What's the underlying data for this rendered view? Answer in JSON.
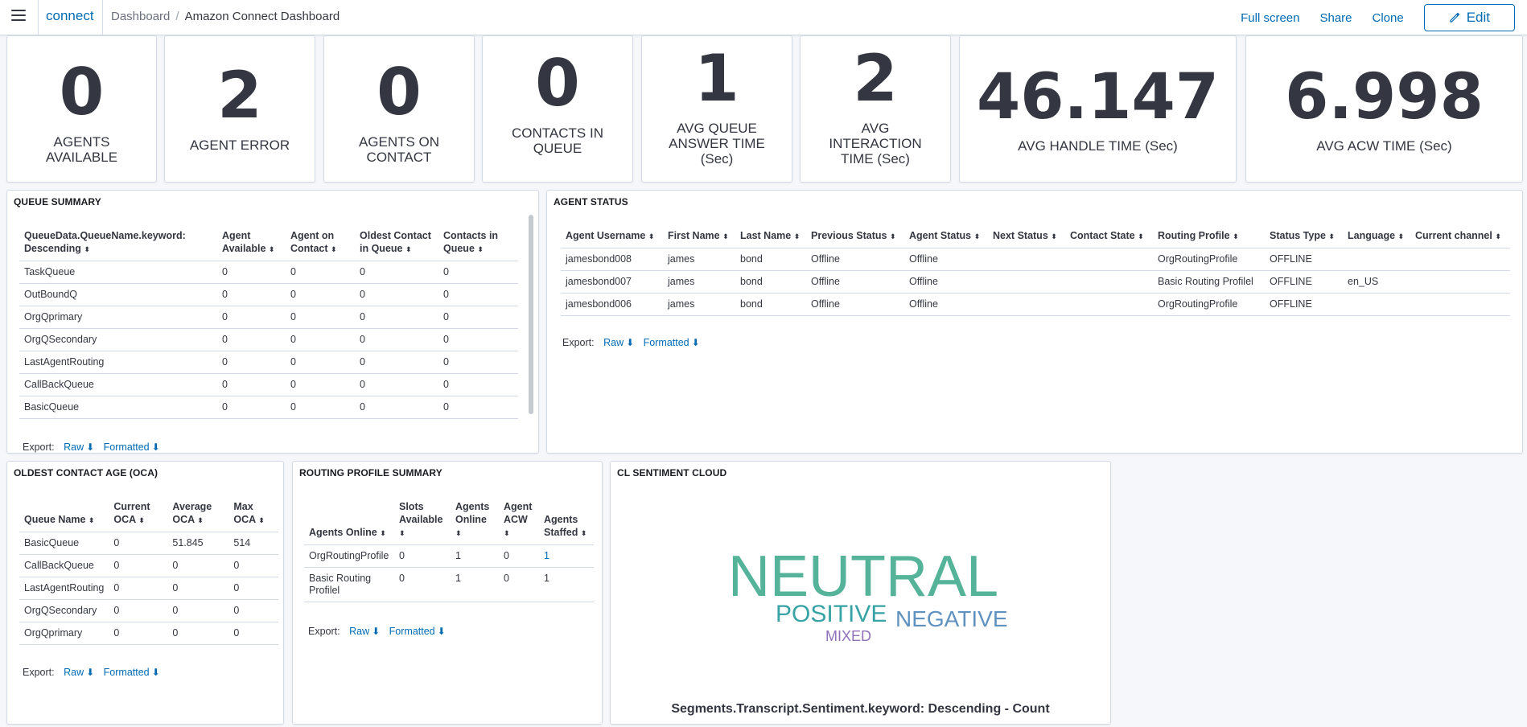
{
  "header": {
    "brand": "connect",
    "breadcrumb": [
      "Dashboard",
      "Amazon Connect Dashboard"
    ],
    "actions": [
      "Full screen",
      "Share",
      "Clone"
    ],
    "edit_label": "Edit"
  },
  "metrics": [
    {
      "value": "0",
      "label": "AGENTS AVAILABLE"
    },
    {
      "value": "2",
      "label": "AGENT ERROR"
    },
    {
      "value": "0",
      "label": "AGENTS ON CONTACT"
    },
    {
      "value": "0",
      "label": "CONTACTS IN QUEUE"
    },
    {
      "value": "1",
      "label": "AVG QUEUE ANSWER TIME (Sec)"
    },
    {
      "value": "2",
      "label": "AVG INTERACTION TIME (Sec)"
    },
    {
      "value": "46.147",
      "label": "AVG HANDLE TIME (Sec)"
    },
    {
      "value": "6.998",
      "label": "AVG ACW TIME (Sec)"
    }
  ],
  "queue_summary": {
    "title": "QUEUE SUMMARY",
    "columns": [
      "QueueData.QueueName.keyword: Descending",
      "Agent Available",
      "Agent on Contact",
      "Oldest Contact in Queue",
      "Contacts in Queue"
    ],
    "rows": [
      [
        "TaskQueue",
        "0",
        "0",
        "0",
        "0"
      ],
      [
        "OutBoundQ",
        "0",
        "0",
        "0",
        "0"
      ],
      [
        "OrgQprimary",
        "0",
        "0",
        "0",
        "0"
      ],
      [
        "OrgQSecondary",
        "0",
        "0",
        "0",
        "0"
      ],
      [
        "LastAgentRouting",
        "0",
        "0",
        "0",
        "0"
      ],
      [
        "CallBackQueue",
        "0",
        "0",
        "0",
        "0"
      ],
      [
        "BasicQueue",
        "0",
        "0",
        "0",
        "0"
      ]
    ]
  },
  "agent_status": {
    "title": "AGENT STATUS",
    "columns": [
      "Agent Username",
      "First Name",
      "Last Name",
      "Previous Status",
      "Agent Status",
      "Next Status",
      "Contact State",
      "Routing Profile",
      "Status Type",
      "Language",
      "Current channel"
    ],
    "rows": [
      [
        "jamesbond008",
        "james",
        "bond",
        "Offline",
        "Offline",
        "",
        "",
        "OrgRoutingProfile",
        "OFFLINE",
        "",
        ""
      ],
      [
        "jamesbond007",
        "james",
        "bond",
        "Offline",
        "Offline",
        "",
        "",
        "Basic Routing Profilel",
        "OFFLINE",
        "en_US",
        ""
      ],
      [
        "jamesbond006",
        "james",
        "bond",
        "Offline",
        "Offline",
        "",
        "",
        "OrgRoutingProfile",
        "OFFLINE",
        "",
        ""
      ]
    ]
  },
  "oca": {
    "title": "OLDEST CONTACT AGE (OCA)",
    "columns": [
      "Queue Name",
      "Current OCA",
      "Average OCA",
      "Max OCA"
    ],
    "rows": [
      [
        "BasicQueue",
        "0",
        "51.845",
        "514"
      ],
      [
        "CallBackQueue",
        "0",
        "0",
        "0"
      ],
      [
        "LastAgentRouting",
        "0",
        "0",
        "0"
      ],
      [
        "OrgQSecondary",
        "0",
        "0",
        "0"
      ],
      [
        "OrgQprimary",
        "0",
        "0",
        "0"
      ]
    ]
  },
  "routing": {
    "title": "ROUTING PROFILE SUMMARY",
    "columns": [
      "Agents Online",
      "Slots Available",
      "Agents Online",
      "Agent ACW",
      "Agents Staffed"
    ],
    "rows": [
      [
        "OrgRoutingProfile",
        "0",
        "1",
        "0",
        "1"
      ],
      [
        "Basic Routing Profilel",
        "0",
        "1",
        "0",
        "1"
      ]
    ]
  },
  "sentiment": {
    "title": "CL SENTIMENT CLOUD",
    "words": [
      {
        "text": "NEUTRAL",
        "color": "#54b399"
      },
      {
        "text": "POSITIVE",
        "color": "#38a3a5"
      },
      {
        "text": "NEGATIVE",
        "color": "#6092c0"
      },
      {
        "text": "MIXED",
        "color": "#9170b8"
      }
    ],
    "caption": "Segments.Transcript.Sentiment.keyword: Descending - Count"
  },
  "export": {
    "label": "Export:",
    "raw": "Raw",
    "formatted": "Formatted"
  },
  "icons": {
    "sort": "sort-icon",
    "download": "download-icon",
    "menu": "hamburger-icon",
    "pencil": "pencil-icon"
  }
}
